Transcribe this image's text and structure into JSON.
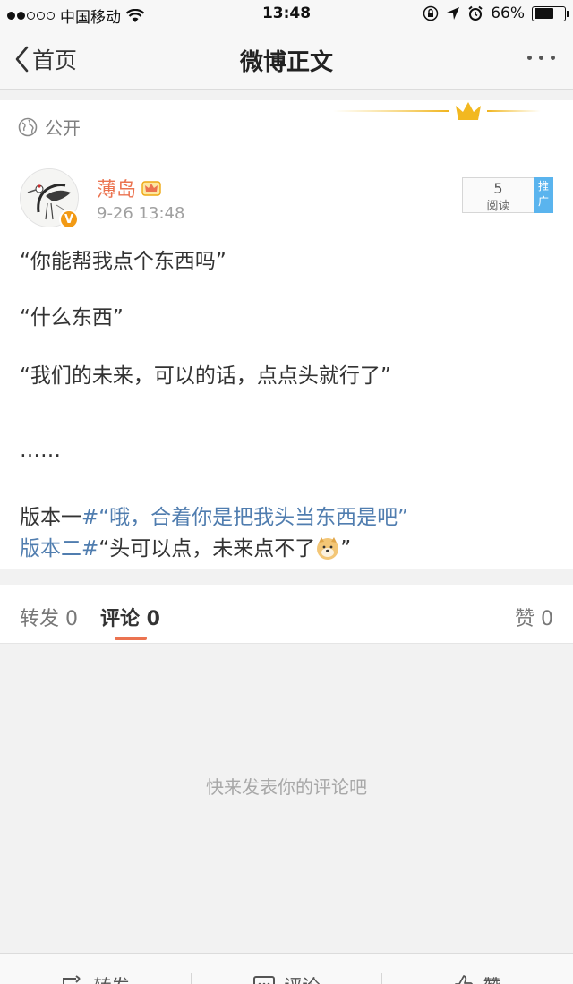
{
  "status_bar": {
    "carrier": "中国移动",
    "time": "13:48",
    "battery": "66%",
    "battery_level": 0.66
  },
  "nav": {
    "back_label": "首页",
    "title": "微博正文"
  },
  "visibility": {
    "label": "公开",
    "icon": "globe-icon"
  },
  "post": {
    "author": "薄岛",
    "time": "9-26 13:48",
    "read_count": "5",
    "read_label": "阅读",
    "promote_label": "推广",
    "lines": [
      "“你能帮我点个东西吗”",
      "“什么东西”",
      "“我们的未来，可以的话，点点头就行了”",
      "……"
    ],
    "version1_prefix": "版本一",
    "version1_link": "#“哦，合着你是把我头当东西是吧”",
    "version2_link": "版本二#",
    "version2_text": "“头可以点，未来点不了",
    "version2_suffix": "”"
  },
  "tabs": {
    "repost": "转发 0",
    "comment": "评论 0",
    "like": "赞 0"
  },
  "empty_message": "快来发表你的评论吧",
  "toolbar": {
    "repost": "转发",
    "comment": "评论",
    "like": "赞"
  },
  "colors": {
    "accent": "#eb7350",
    "link": "#507daf",
    "promote": "#5ab4ee"
  }
}
